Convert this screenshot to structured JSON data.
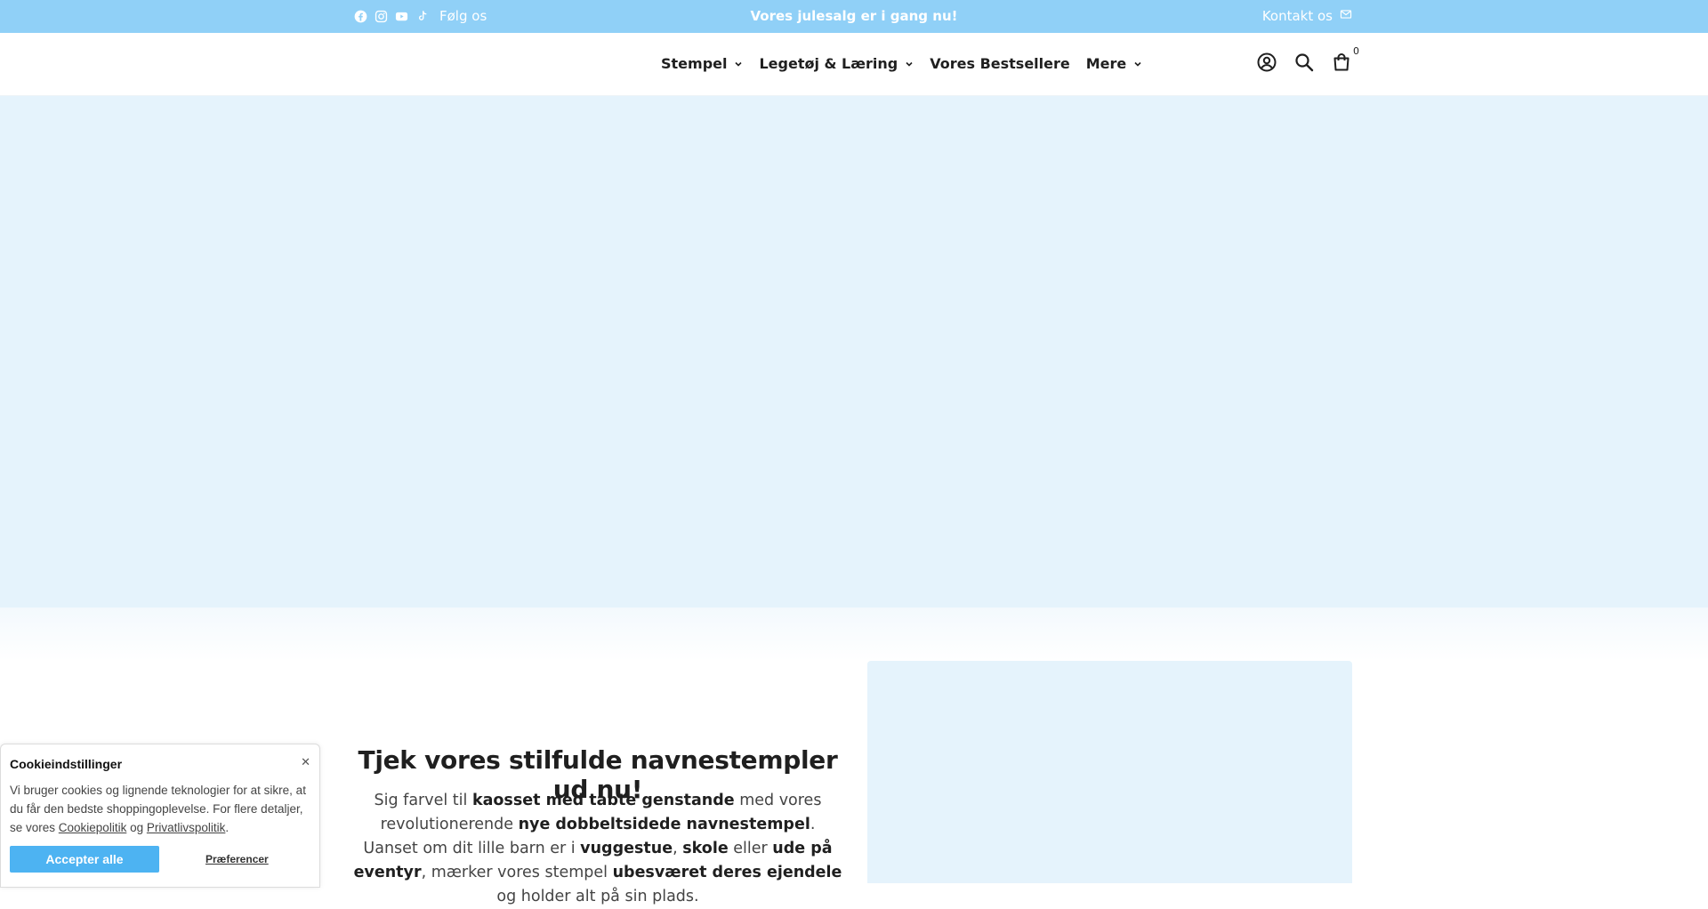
{
  "topbar": {
    "social_icons": [
      "facebook-icon",
      "instagram-icon",
      "youtube-icon",
      "tiktok-icon"
    ],
    "follow_label": "Følg os",
    "promo": "Vores julesalg er i gang nu!",
    "contact_label": "Kontakt os",
    "background": "#90d0f7"
  },
  "nav": {
    "items": [
      {
        "label": "Stempel",
        "has_dropdown": true
      },
      {
        "label": "Legetøj & Læring",
        "has_dropdown": true
      },
      {
        "label": "Vores Bestsellere",
        "has_dropdown": false
      },
      {
        "label": "Mere",
        "has_dropdown": true
      }
    ]
  },
  "header_icons": {
    "account": "account-icon",
    "search": "search-icon",
    "cart": "cart-icon",
    "cart_count": "0"
  },
  "feature": {
    "title": "Tjek vores stilfulde navnestempler ud nu!",
    "text_parts": [
      {
        "t": "Sig farvel til ",
        "b": false
      },
      {
        "t": "kaosset med tabte genstande",
        "b": true
      },
      {
        "t": " med vores revolutionerende ",
        "b": false
      },
      {
        "t": "nye dobbeltsidede navnestempel",
        "b": true
      },
      {
        "t": ". Uanset om dit lille barn er i ",
        "b": false
      },
      {
        "t": "vuggestue",
        "b": true
      },
      {
        "t": ", ",
        "b": false
      },
      {
        "t": "skole",
        "b": true
      },
      {
        "t": " eller ",
        "b": false
      },
      {
        "t": "ude på eventyr",
        "b": true
      },
      {
        "t": ", mærker vores stempel ",
        "b": false
      },
      {
        "t": "ubesværet deres ejendele",
        "b": true
      },
      {
        "t": " og holder alt på sin plads.",
        "b": false
      }
    ]
  },
  "cookie": {
    "title": "Cookieindstillinger",
    "close_glyph": "",
    "text_before": "Vi bruger cookies og lignende teknologier for at sikre, at du får den bedste shoppingoplevelse. For flere detaljer, se vores ",
    "link_cookie": "Cookiepolitik",
    "text_and": " og ",
    "link_privacy": "Privatlivspolitik",
    "text_end": ".",
    "accept_label": "Accepter alle",
    "prefs_label": "Præferencer",
    "accent": "#4db3f2"
  },
  "colors": {
    "hero_bg": "#e5f3fc",
    "text": "#1f1f1f"
  }
}
